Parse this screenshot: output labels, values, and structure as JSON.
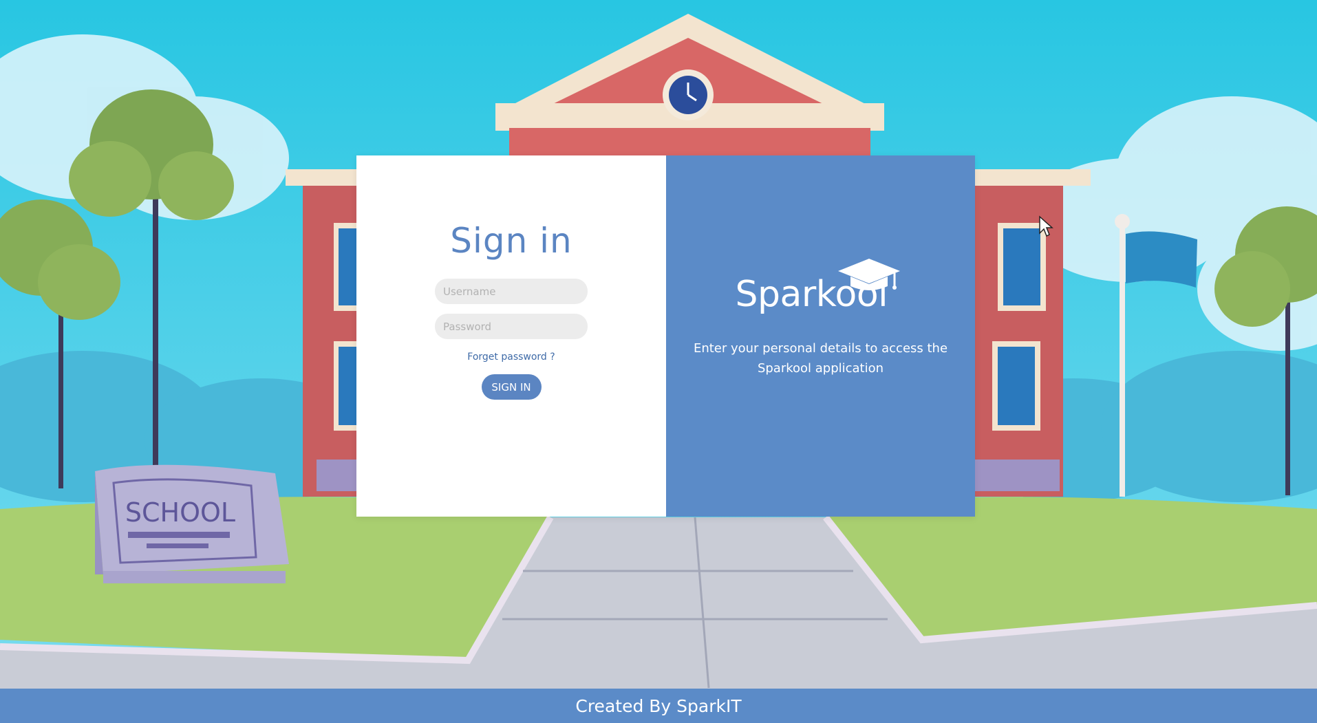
{
  "signin": {
    "title": "Sign in",
    "username_placeholder": "Username",
    "password_placeholder": "Password",
    "forgot_link": "Forget password ?",
    "button_label": "SIGN IN"
  },
  "brand": {
    "logo_text": "Sparkool",
    "logo_icon": "graduation-cap-icon",
    "tagline": "Enter your personal details to access the Sparkool application"
  },
  "background": {
    "sign_text": "SCHOOL"
  },
  "footer": {
    "text": "Created By SparkIT"
  },
  "colors": {
    "accent": "#5b85c2",
    "panel": "#5b8bc8",
    "sky": "#2ec9e3",
    "field_bg": "#ececec"
  }
}
